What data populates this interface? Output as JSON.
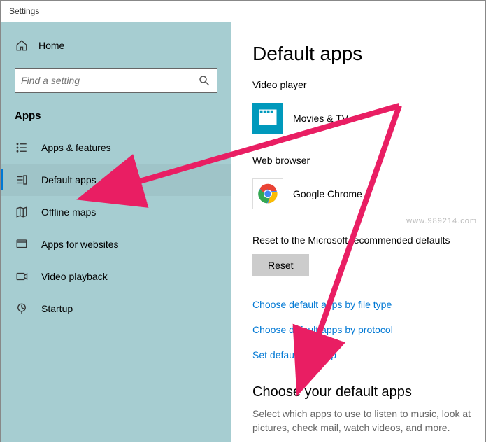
{
  "window": {
    "title": "Settings"
  },
  "sidebar": {
    "home_label": "Home",
    "search_placeholder": "Find a setting",
    "section_heading": "Apps",
    "items": [
      {
        "label": "Apps & features"
      },
      {
        "label": "Default apps"
      },
      {
        "label": "Offline maps"
      },
      {
        "label": "Apps for websites"
      },
      {
        "label": "Video playback"
      },
      {
        "label": "Startup"
      }
    ]
  },
  "main": {
    "title": "Default apps",
    "video_player_label": "Video player",
    "video_player_app": "Movies & TV",
    "web_browser_label": "Web browser",
    "web_browser_app": "Google Chrome",
    "reset_text": "Reset to the Microsoft recommended defaults",
    "reset_button": "Reset",
    "links": {
      "by_file_type": "Choose default apps by file type",
      "by_protocol": "Choose default apps by protocol",
      "by_app": "Set defaults by app"
    },
    "choose_heading": "Choose your default apps",
    "choose_desc": "Select which apps to use to listen to music, look at pictures, check mail, watch videos, and more."
  },
  "watermark": "www.989214.com"
}
